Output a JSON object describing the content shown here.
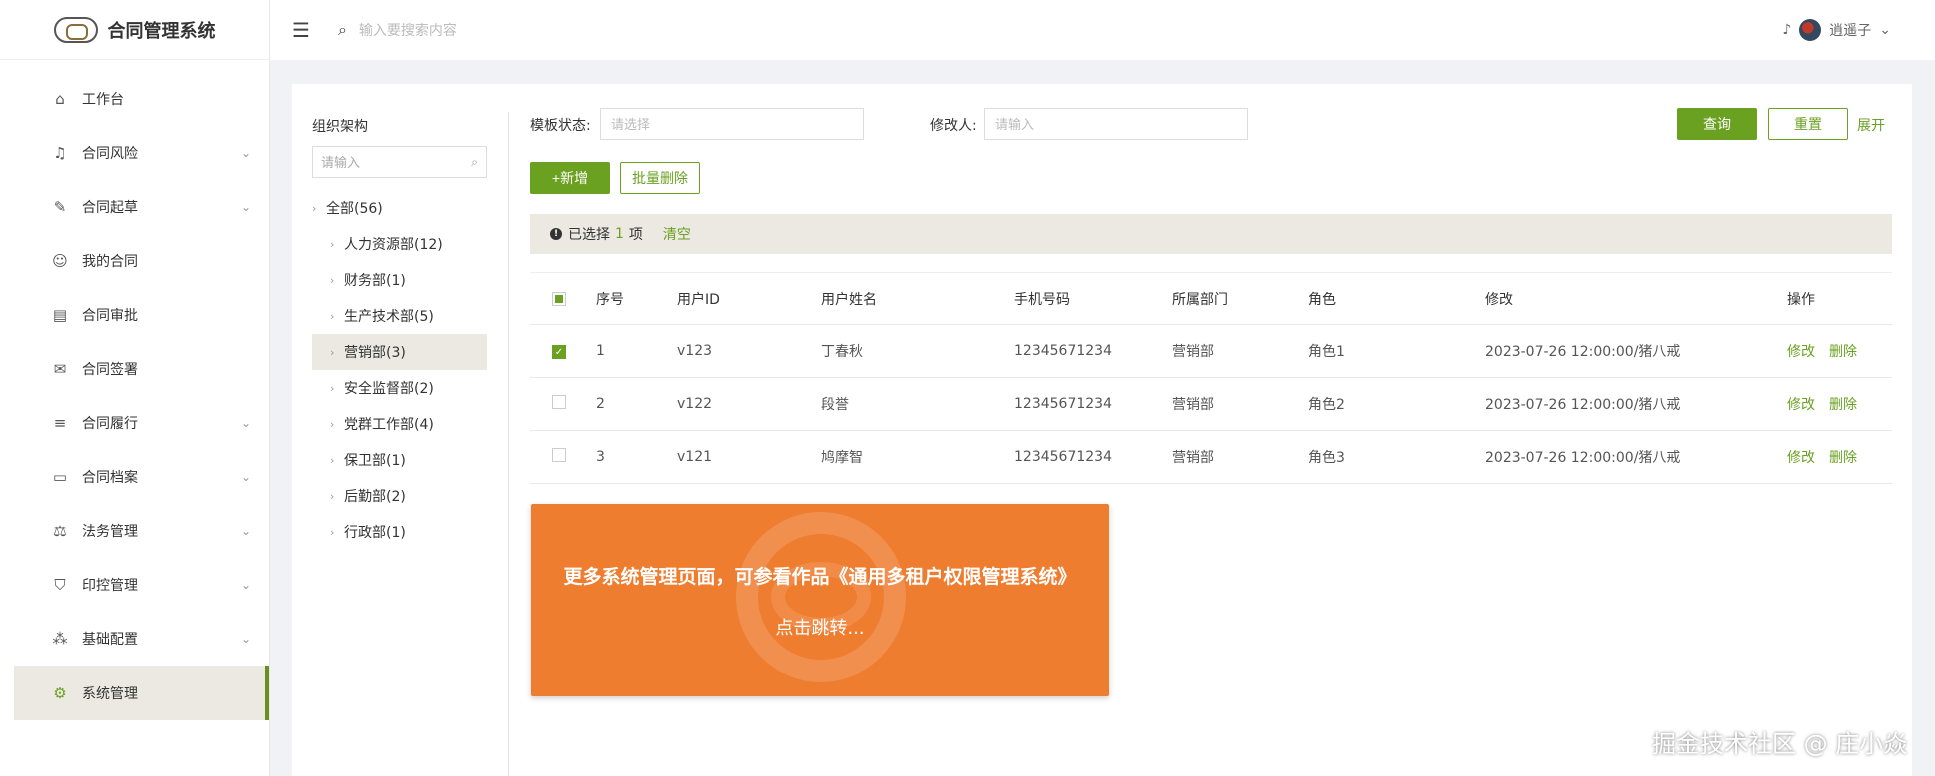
{
  "app": {
    "title": "合同管理系统"
  },
  "sidebar": {
    "items": [
      {
        "label": "工作台",
        "icon": "home-icon",
        "glyph": "⌂",
        "arrow": ""
      },
      {
        "label": "合同风险",
        "icon": "bell-icon",
        "glyph": "♫",
        "arrow": "⌄"
      },
      {
        "label": "合同起草",
        "icon": "edit-icon",
        "glyph": "✎",
        "arrow": "⌄"
      },
      {
        "label": "我的合同",
        "icon": "user-icon",
        "glyph": "☺",
        "arrow": ""
      },
      {
        "label": "合同审批",
        "icon": "id-card-icon",
        "glyph": "▤",
        "arrow": ""
      },
      {
        "label": "合同签署",
        "icon": "chat-icon",
        "glyph": "✉",
        "arrow": ""
      },
      {
        "label": "合同履行",
        "icon": "list-icon",
        "glyph": "≡",
        "arrow": "⌄"
      },
      {
        "label": "合同档案",
        "icon": "laptop-icon",
        "glyph": "▭",
        "arrow": "⌄"
      },
      {
        "label": "法务管理",
        "icon": "gavel-icon",
        "glyph": "⚖",
        "arrow": "⌄"
      },
      {
        "label": "印控管理",
        "icon": "shield-icon",
        "glyph": "⛉",
        "arrow": "⌄"
      },
      {
        "label": "基础配置",
        "icon": "cubes-icon",
        "glyph": "⁂",
        "arrow": "⌄"
      },
      {
        "label": "系统管理",
        "icon": "gear-icon",
        "glyph": "⚙",
        "arrow": ""
      }
    ],
    "active_index": 11
  },
  "topbar": {
    "search_placeholder": "输入要搜索内容",
    "user_name": "逍遥子",
    "menu_glyph": "☰",
    "search_glyph": "⌕",
    "bell_glyph": "♪",
    "caret_glyph": "⌄"
  },
  "tree": {
    "title": "组织架构",
    "search_placeholder": "请输入",
    "search_glyph": "⌕",
    "chevron": "›",
    "root": "全部(56)",
    "children": [
      "人力资源部(12)",
      "财务部(1)",
      "生产技术部(5)",
      "营销部(3)",
      "安全监督部(2)",
      "党群工作部(4)",
      "保卫部(1)",
      "后勤部(2)",
      "行政部(1)"
    ],
    "selected_index": 3
  },
  "filters": {
    "template_status_label": "模板状态:",
    "template_status_placeholder": "请选择",
    "modifier_label": "修改人:",
    "modifier_placeholder": "请输入",
    "query_label": "查询",
    "reset_label": "重置",
    "expand_label": "展开"
  },
  "toolbar": {
    "add_label": "+新增",
    "batch_delete_label": "批量删除"
  },
  "selection": {
    "icon_glyph": "!",
    "prefix": "已选择",
    "count": "1",
    "suffix": "项",
    "clear_label": "清空"
  },
  "table": {
    "columns": [
      "序号",
      "用户ID",
      "用户姓名",
      "手机号码",
      "所属部门",
      "角色",
      "修改",
      "操作"
    ],
    "check_glyph": "✓",
    "rows": [
      {
        "no": "1",
        "id": "v123",
        "name": "丁春秋",
        "phone": "12345671234",
        "dept": "营销部",
        "role": "角色1",
        "modified": "2023-07-26 12:00:00/猪八戒",
        "edit": "修改",
        "delete": "删除",
        "checked": true
      },
      {
        "no": "2",
        "id": "v122",
        "name": "段誉",
        "phone": "12345671234",
        "dept": "营销部",
        "role": "角色2",
        "modified": "2023-07-26 12:00:00/猪八戒",
        "edit": "修改",
        "delete": "删除",
        "checked": false
      },
      {
        "no": "3",
        "id": "v121",
        "name": "鸠摩智",
        "phone": "12345671234",
        "dept": "营销部",
        "role": "角色3",
        "modified": "2023-07-26 12:00:00/猪八戒",
        "edit": "修改",
        "delete": "删除",
        "checked": false
      }
    ]
  },
  "promo": {
    "main_text": "更多系统管理页面，可参看作品《通用多租户权限管理系统》",
    "sub_text": "点击跳转..."
  },
  "watermark": {
    "text": "掘金技术社区 @ 庄小焱"
  },
  "colors": {
    "accent": "#6aa121",
    "promo": "#ef7d2f",
    "selected_bg": "#ece8e2"
  }
}
